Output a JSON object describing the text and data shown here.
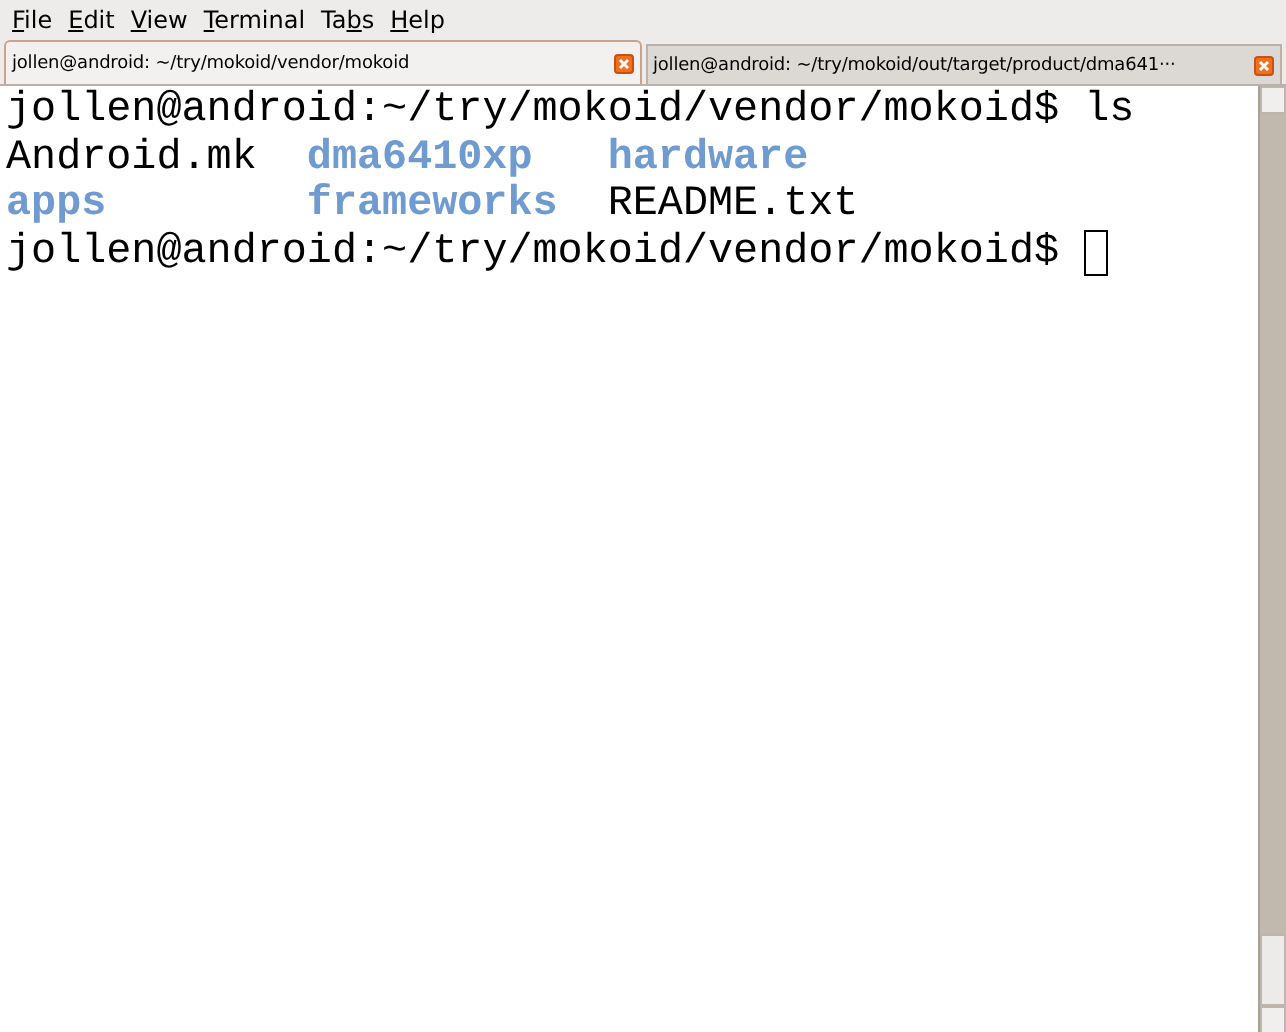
{
  "menu": [
    {
      "access_key": "F",
      "after": "ile"
    },
    {
      "access_key": "E",
      "after": "dit"
    },
    {
      "access_key": "V",
      "after": "iew"
    },
    {
      "access_key": "T",
      "after": "erminal"
    },
    {
      "before": "Ta",
      "access_key": "b",
      "after": "s"
    },
    {
      "access_key": "H",
      "after": "elp"
    }
  ],
  "tabs": [
    {
      "title": "jollen@android: ~/try/mokoid/vendor/mokoid",
      "selected": true
    },
    {
      "title": "jollen@android: ~/try/mokoid/out/target/product/dma641···",
      "selected": false
    }
  ],
  "terminal": {
    "lines": [
      {
        "kind": "prompt",
        "prompt": "jollen@android:~/try/mokoid/vendor/mokoid$",
        "command": "ls",
        "cursor": false
      },
      {
        "kind": "listing",
        "entries": [
          {
            "name": "Android.mk",
            "kind": "file"
          },
          {
            "name": "dma6410xp",
            "kind": "directory"
          },
          {
            "name": "hardware",
            "kind": "directory"
          }
        ]
      },
      {
        "kind": "listing",
        "entries": [
          {
            "name": "apps",
            "kind": "directory"
          },
          {
            "name": "frameworks",
            "kind": "directory"
          },
          {
            "name": "README.txt",
            "kind": "file"
          }
        ]
      },
      {
        "kind": "prompt",
        "prompt": "jollen@android:~/try/mokoid/vendor/mokoid$",
        "cursor": true
      }
    ]
  }
}
